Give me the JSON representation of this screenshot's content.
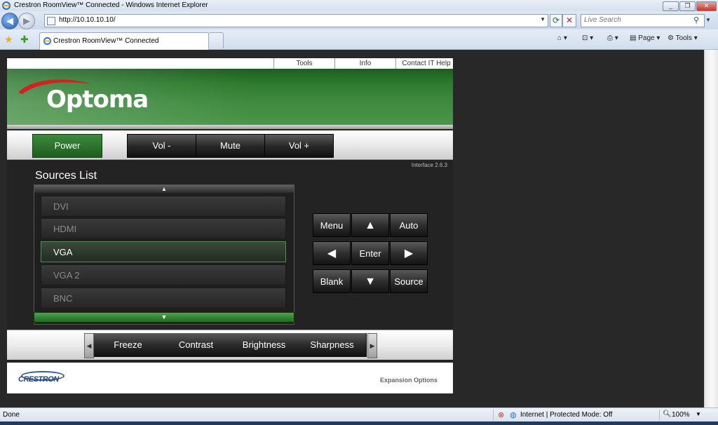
{
  "window": {
    "title": "Crestron RoomView™ Connected - Windows Internet Explorer",
    "controls": [
      "_",
      "❐",
      "✕"
    ]
  },
  "address": {
    "url": "http://10.10.10.10/",
    "search_placeholder": "Live Search"
  },
  "tab": {
    "label": "Crestron RoomView™ Connected"
  },
  "commands": {
    "page": "Page",
    "tools": "Tools"
  },
  "panel": {
    "topnav": [
      "Tools",
      "Info",
      "Contact IT Help"
    ],
    "brand": "Optoma",
    "controls": {
      "power": "Power",
      "vol_down": "Vol -",
      "mute": "Mute",
      "vol_up": "Vol +"
    },
    "version": "Interface 2.6.3",
    "sources_title": "Sources List",
    "sources": [
      "DVI",
      "HDMI",
      "VGA",
      "VGA 2",
      "BNC"
    ],
    "selected_source": "VGA",
    "pad": {
      "menu": "Menu",
      "auto": "Auto",
      "enter": "Enter",
      "blank": "Blank",
      "source": "Source"
    },
    "bottom": [
      "Freeze",
      "Contrast",
      "Brightness",
      "Sharpness"
    ],
    "footer_brand": "CRESTRON",
    "expansion": "Expansion Options"
  },
  "status": {
    "left": "Done",
    "zone": "Internet | Protected Mode: Off",
    "zoom": "100%"
  },
  "colors": {
    "accent_green": "#2c7a2d",
    "panel_bg": "#232323"
  }
}
